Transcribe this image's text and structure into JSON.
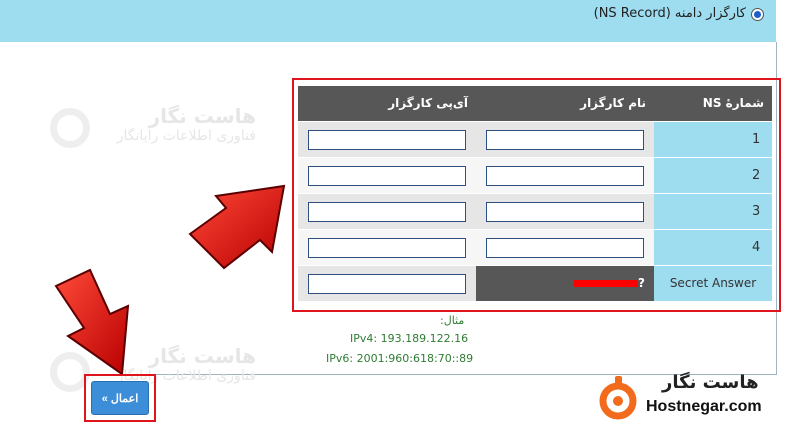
{
  "header": {
    "radio_label": "کارگزار دامنه (NS Record)",
    "radio_selected": true
  },
  "watermark": {
    "title": "هاست نگار",
    "subtitle": "فناوری اطلاعات رایانگار"
  },
  "ns_table": {
    "col_number": "شمارهٔ NS",
    "col_name": "نام کارگزار",
    "col_ip": "آی‌پی کارگزار",
    "rows": [
      {
        "number": "1",
        "name": "",
        "ip": ""
      },
      {
        "number": "2",
        "name": "",
        "ip": ""
      },
      {
        "number": "3",
        "name": "",
        "ip": ""
      },
      {
        "number": "4",
        "name": "",
        "ip": ""
      }
    ],
    "secret_label": "Secret Answer",
    "secret_question_suffix": "?",
    "secret_answer": ""
  },
  "hints": {
    "example_label": "مثال:",
    "ipv4": "IPv4: 193.189.122.16",
    "ipv6": "IPv6: 2001:960:618:70::89"
  },
  "apply_button": {
    "label": "اعمال »"
  },
  "branding": {
    "name_fa": "هاست نگار",
    "name_en": "Hostnegar.com"
  },
  "colors": {
    "top_bar": "#9edcf0",
    "table_header": "#575757",
    "highlight": "#e0141c",
    "button": "#3d8ed8",
    "brand_orange": "#f26a1b"
  }
}
